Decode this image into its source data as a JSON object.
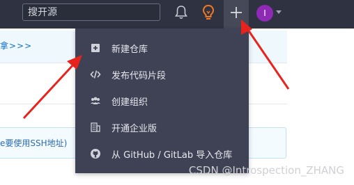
{
  "header": {
    "search_placeholder": "搜开源",
    "avatar_initial": "I",
    "icons": [
      "bell-icon",
      "lightbulb-icon",
      "plus-icon",
      "avatar",
      "caret-down-icon"
    ]
  },
  "background": {
    "notice_text": "拿>>>",
    "info_text": "e要使用SSH地址)"
  },
  "dropdown": {
    "items": [
      {
        "label": "新建仓库",
        "icon": "plus-square-icon"
      },
      {
        "label": "发布代码片段",
        "icon": "code-icon"
      },
      {
        "label": "创建组织",
        "icon": "users-icon"
      },
      {
        "label": "开通企业版",
        "icon": "building-icon"
      },
      {
        "label": "从 GitHub / GitLab 导入仓库",
        "icon": "github-icon"
      }
    ]
  },
  "colors": {
    "topbar": "#2f3241",
    "menu": "#3f4254",
    "accent_orange": "#f07b22",
    "avatar": "#8f2ab5",
    "arrow_red": "#e8231e"
  },
  "watermark": "CSDN @Introspection_ZHANG"
}
